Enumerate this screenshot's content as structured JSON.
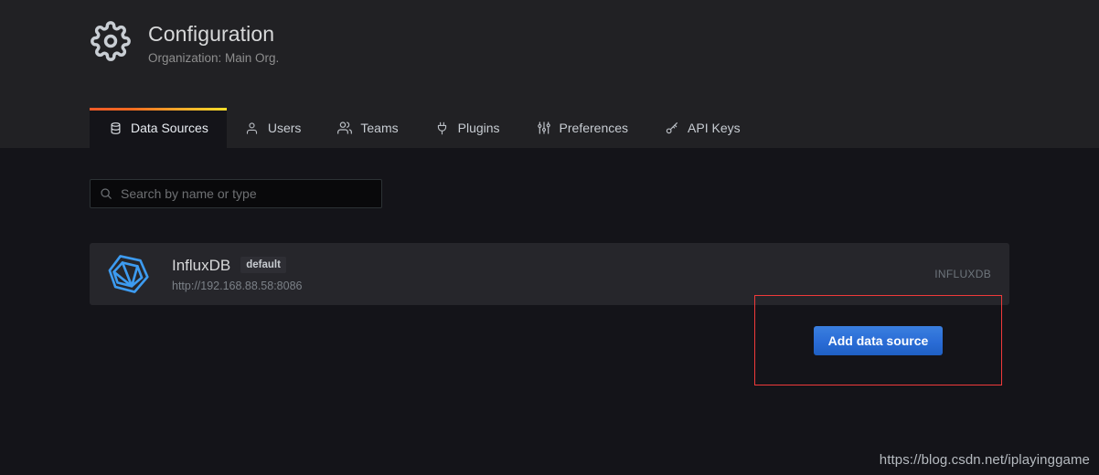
{
  "header": {
    "icon": "gear-icon",
    "title": "Configuration",
    "subtitle": "Organization: Main Org."
  },
  "tabs": [
    {
      "label": "Data Sources",
      "icon": "database-icon",
      "active": true
    },
    {
      "label": "Users",
      "icon": "user-icon",
      "active": false
    },
    {
      "label": "Teams",
      "icon": "users-icon",
      "active": false
    },
    {
      "label": "Plugins",
      "icon": "plug-icon",
      "active": false
    },
    {
      "label": "Preferences",
      "icon": "sliders-icon",
      "active": false
    },
    {
      "label": "API Keys",
      "icon": "key-icon",
      "active": false
    }
  ],
  "toolbar": {
    "search": {
      "placeholder": "Search by name or type",
      "value": "",
      "icon": "search-icon"
    },
    "add_button_label": "Add data source"
  },
  "annotation": {
    "color": "#f03a3a",
    "shape": "rectangle"
  },
  "datasources": [
    {
      "name": "InfluxDB",
      "badge": "default",
      "url": "http://192.168.88.58:8086",
      "type": "INFLUXDB",
      "logo": "influxdb-logo"
    }
  ],
  "watermark": "https://blog.csdn.net/iplayinggame",
  "colors": {
    "header_bg": "#212124",
    "content_bg": "#141419",
    "card_bg": "#26262b",
    "accent_start": "#f05a28",
    "accent_end": "#fade2a",
    "primary_button": "#2a6cd6",
    "annotation": "#f03a3a",
    "influx_blue": "#3d9bf0"
  }
}
